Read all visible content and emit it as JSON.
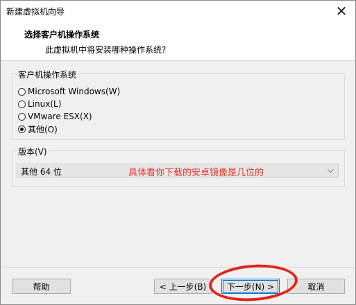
{
  "window": {
    "title": "新建虚拟机向导"
  },
  "header": {
    "title": "选择客户机操作系统",
    "subtitle": "此虚拟机中将安装哪种操作系统?"
  },
  "os_group": {
    "label": "客户机操作系统",
    "options": [
      {
        "label": "Microsoft Windows(W)",
        "checked": false
      },
      {
        "label": "Linux(L)",
        "checked": false
      },
      {
        "label": "VMware ESX(X)",
        "checked": false
      },
      {
        "label": "其他(O)",
        "checked": true
      }
    ]
  },
  "version_group": {
    "label": "版本(V)",
    "selected": "其他 64 位"
  },
  "annotation": {
    "text": "具体看你下载的安卓镜像是几位的",
    "color": "#e23b2e"
  },
  "buttons": {
    "help": "帮助",
    "back": "< 上一步(B)",
    "next": "下一步(N) >",
    "cancel": "取消"
  }
}
